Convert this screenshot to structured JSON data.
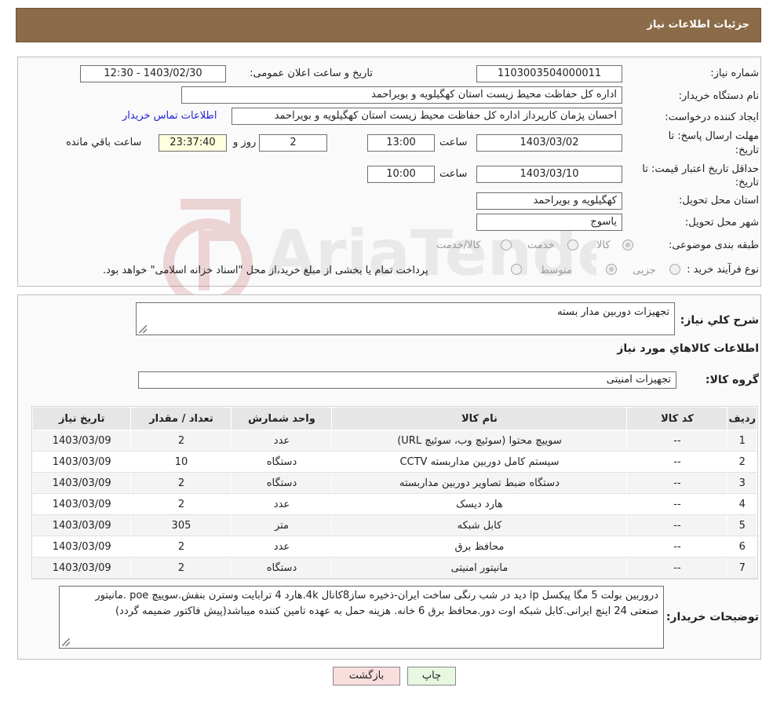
{
  "header": {
    "title": "جزئیات اطلاعات نیاز"
  },
  "info": {
    "need_number_label": "شماره نیاز:",
    "need_number": "1103003504000011",
    "announce_label": "تاریخ و ساعت اعلان عمومی:",
    "announce_value": "1403/02/30 - 12:30",
    "buyer_org_label": "نام دستگاه خریدار:",
    "buyer_org": "اداره کل حفاظت محیط زیست استان کهگیلویه و بویراحمد",
    "creator_label": "ایجاد کننده درخواست:",
    "creator": "احسان پژمان کارپرداز اداره کل حفاظت محیط زیست استان کهگیلویه و بویراحمد",
    "contact_link": "اطلاعات تماس خریدار",
    "reply_deadline_label_1": "مهلت ارسال پاسخ: تا",
    "reply_deadline_label_2": "تاریخ:",
    "reply_date": "1403/03/02",
    "time_label": "ساعت",
    "reply_time": "13:00",
    "days_value": "2",
    "days_label": "روز و",
    "remaining_value": "23:37:40",
    "remaining_label": "ساعت باقي مانده",
    "validity_label_1": "حداقل تاریخ اعتبار قیمت: تا",
    "validity_label_2": "تاریخ:",
    "validity_date": "1403/03/10",
    "validity_time": "10:00",
    "province_label": "استان محل تحویل:",
    "province": "کهگیلویه و بویراحمد",
    "city_label": "شهر محل تحویل:",
    "city": "یاسوج",
    "category_label": "طبقه بندی موضوعی:",
    "category_options": [
      "کالا",
      "خدمت",
      "کالا/خدمت"
    ],
    "purchase_type_label": "نوع فرآیند خرید :",
    "purchase_options": [
      "جزیی",
      "متوسط"
    ],
    "purchase_note": "پرداخت تمام یا بخشی از مبلغ خرید،از محل \"اسناد خزانه اسلامی\" خواهد بود."
  },
  "details": {
    "summary_label": "شرح کلي نياز:",
    "summary": "تجهیزات دوربین مدار بسته",
    "goods_heading": "اطلاعات کالاهاي مورد نياز",
    "group_label": "گروه کالا:",
    "group_value": "تجهیزات امنیتی",
    "table": {
      "headers": [
        "رديف",
        "کد کالا",
        "نام کالا",
        "واحد شمارش",
        "تعداد / مقدار",
        "تاریخ نیاز"
      ],
      "rows": [
        [
          "1",
          "--",
          "سوییچ محتوا (سوئیچ وب، سوئیچ URL)",
          "عدد",
          "2",
          "1403/03/09"
        ],
        [
          "2",
          "--",
          "سیستم کامل دوربین مداربسته CCTV",
          "دستگاه",
          "10",
          "1403/03/09"
        ],
        [
          "3",
          "--",
          "دستگاه ضبط تصاویر دوربین مداربسته",
          "دستگاه",
          "2",
          "1403/03/09"
        ],
        [
          "4",
          "--",
          "هارد دیسک",
          "عدد",
          "2",
          "1403/03/09"
        ],
        [
          "5",
          "--",
          "کابل شبکه",
          "متر",
          "305",
          "1403/03/09"
        ],
        [
          "6",
          "--",
          "محافظ برق",
          "عدد",
          "2",
          "1403/03/09"
        ],
        [
          "7",
          "--",
          "مانیتور امنیتی",
          "دستگاه",
          "2",
          "1403/03/09"
        ]
      ]
    },
    "buyer_notes_label": "توضیحات خریدار:",
    "buyer_notes": "دروربین بولت 5 مگا پیکسل ip دید در شب رنگی ساخت ایران-ذخیره ساز8کانال 4k.هارد 4 ترابایت وسترن بنفش.سوییچ poe .مانیتور صنعتی 24 اینچ ایرانی.کابل شبکه اوت دور.محافظ برق 6 خانه. هزینه حمل به عهده تامین کننده میباشد(پیش فاکتور ضمیمه گردد)"
  },
  "buttons": {
    "print": "چاپ",
    "back": "بازگشت"
  },
  "watermark": {
    "text": "AriaTender.neT"
  },
  "colors": {
    "header_bg": "#8b6b48",
    "link": "#2222dd",
    "back_btn": "#f9dede",
    "print_btn": "#e8f7e0"
  }
}
